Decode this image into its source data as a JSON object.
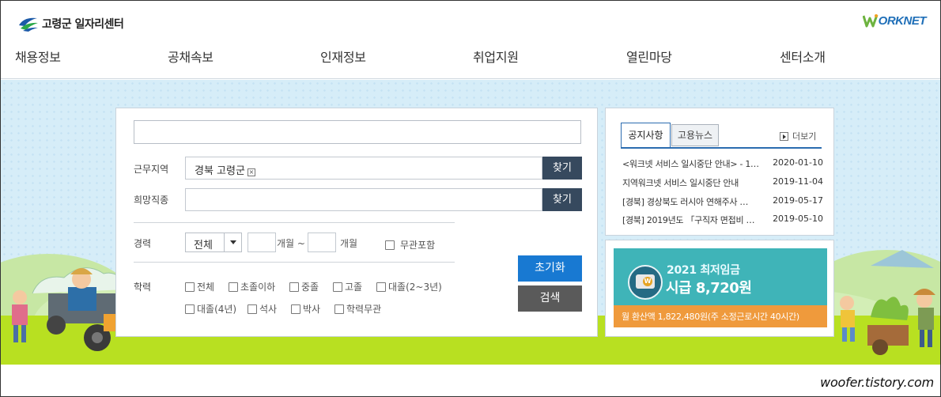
{
  "header": {
    "logo_text": "고령군 일자리센터",
    "partner_logo_text": "ORKNET"
  },
  "nav": {
    "items": [
      {
        "label": "채용정보"
      },
      {
        "label": "공채속보"
      },
      {
        "label": "인재정보"
      },
      {
        "label": "취업지원"
      },
      {
        "label": "열린마당"
      },
      {
        "label": "센터소개"
      }
    ]
  },
  "search": {
    "keyword_value": "",
    "region_label": "근무지역",
    "region_value": "경북 고령군",
    "region_remove_symbol": "×",
    "job_label": "희망직종",
    "job_value": "",
    "find_label": "찾기",
    "career_label": "경력",
    "career_selected": "전체",
    "month_from_suffix": "개월 ~",
    "month_to_suffix": "개월",
    "career_any_label": "무관포함",
    "education_label": "학력",
    "education_options": [
      {
        "label": "전체"
      },
      {
        "label": "초졸이하"
      },
      {
        "label": "중졸"
      },
      {
        "label": "고졸"
      },
      {
        "label": "대졸(2~3년)"
      },
      {
        "label": "대졸(4년)"
      },
      {
        "label": "석사"
      },
      {
        "label": "박사"
      },
      {
        "label": "학력무관"
      }
    ],
    "reset_label": "초기화",
    "submit_label": "검색"
  },
  "notice": {
    "tabs": [
      {
        "label": "공지사항",
        "active": true
      },
      {
        "label": "고용뉴스",
        "active": false
      }
    ],
    "more_label": "더보기",
    "items": [
      {
        "title": "<워크넷 서비스 일시중단 안내> - 1…",
        "date": "2020-01-10"
      },
      {
        "title": "지역워크넷 서비스 일시중단 안내",
        "date": "2019-11-04"
      },
      {
        "title": "[경북] 경상북도 러시아 연해주사 …",
        "date": "2019-05-17"
      },
      {
        "title": "[경북] 2019년도 「구직자 면접비 …",
        "date": "2019-05-10"
      }
    ]
  },
  "wage_banner": {
    "year_title": "2021 최저임금",
    "hourly": "시급 8,720원",
    "monthly": "월 환산액 1,822,480원(주 소정근로시간 40시간)",
    "coin_letter": "W"
  },
  "watermark": "woofer.tistory.com",
  "colors": {
    "nav_text": "#333333",
    "find_button": "#36495e",
    "reset_button": "#1879d2",
    "search_button": "#5a5a5a",
    "sky": "#d6edf8",
    "grass": "#b8e021",
    "wage_bg": "#3fb4b8",
    "wage_strip": "#ef9a3c",
    "tab_accent": "#2b6cb0"
  }
}
